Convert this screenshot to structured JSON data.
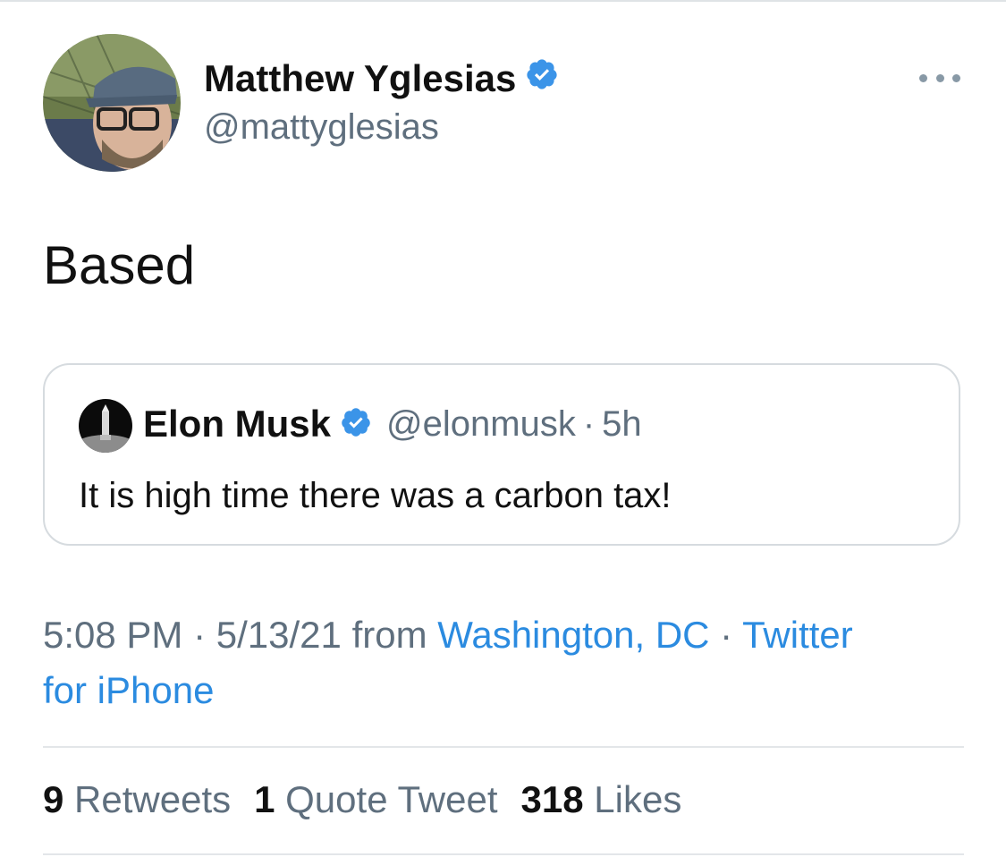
{
  "tweet": {
    "author": {
      "name": "Matthew Yglesias",
      "handle": "@mattyglesias",
      "verified": true
    },
    "text": "Based",
    "quoted_tweet": {
      "author_name": "Elon Musk",
      "handle": "@elonmusk",
      "separator": "·",
      "time": "5h",
      "verified": true,
      "text": "It is high time there was a carbon tax!"
    },
    "metadata": {
      "time": "5:08 PM",
      "date": "5/13/21",
      "from_label": "from",
      "location": "Washington, DC",
      "separator": "·",
      "source_part1": "Twitter",
      "source_part2": "for iPhone"
    },
    "stats": {
      "retweets": {
        "count": "9",
        "label": "Retweets"
      },
      "quote_tweets": {
        "count": "1",
        "label": "Quote Tweet"
      },
      "likes": {
        "count": "318",
        "label": "Likes"
      }
    }
  },
  "icons": {
    "verified": "verified-badge-icon",
    "more": "more-options-icon"
  },
  "colors": {
    "link_blue": "#2b8be0",
    "verified_blue": "#3b94e8",
    "muted_text": "#5f6f7e",
    "border": "#d6dbdf"
  }
}
